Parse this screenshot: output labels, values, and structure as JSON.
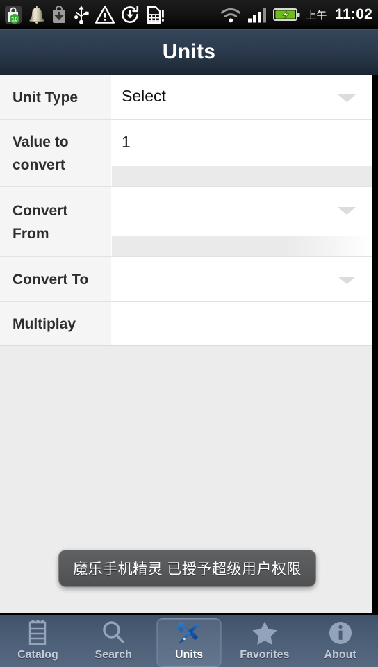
{
  "status_bar": {
    "left_icons": [
      {
        "name": "shop-bag-icon",
        "badge": "10"
      },
      {
        "name": "bell-icon",
        "badge": ""
      },
      {
        "name": "download-bag-icon",
        "badge": ""
      },
      {
        "name": "usb-icon",
        "badge": ""
      },
      {
        "name": "warning-triangle-icon",
        "badge": ""
      },
      {
        "name": "sync-download-icon",
        "badge": ""
      },
      {
        "name": "sim-card-alert-icon",
        "badge": ""
      }
    ],
    "wifi_icon": "wifi-icon",
    "signal_icon": "cellular-signal-icon",
    "battery_icon": "battery-charging-icon",
    "am_pm": "上午",
    "time": "11:02"
  },
  "header": {
    "title": "Units"
  },
  "form": {
    "rows": [
      {
        "key": "unit-type",
        "label": "Unit Type",
        "value": "Select",
        "has_caret": true,
        "has_strip": false
      },
      {
        "key": "value-to-convert",
        "label": "Value to convert",
        "value": "1",
        "has_caret": false,
        "has_strip": true
      },
      {
        "key": "convert-from",
        "label": "Convert From",
        "value": "",
        "has_caret": true,
        "has_strip": true
      },
      {
        "key": "convert-to",
        "label": "Convert To",
        "value": "",
        "has_caret": true,
        "has_strip": false
      },
      {
        "key": "multiplay",
        "label": "Multiplay",
        "value": "",
        "has_caret": false,
        "has_strip": false
      }
    ]
  },
  "toast": {
    "message": "魔乐手机精灵 已授予超级用户权限"
  },
  "tabbar": {
    "tabs": [
      {
        "label": "Catalog",
        "icon": "notepad-icon",
        "active": false
      },
      {
        "label": "Search",
        "icon": "search-icon",
        "active": false
      },
      {
        "label": "Units",
        "icon": "tools-icon",
        "active": true
      },
      {
        "label": "Favorites",
        "icon": "star-icon",
        "active": false
      },
      {
        "label": "About",
        "icon": "info-icon",
        "active": false
      }
    ]
  },
  "colors": {
    "titlebar_top": "#36475c",
    "titlebar_bottom": "#1b2532",
    "tabbar_top": "#3f5168",
    "tabbar_bottom": "#56697f",
    "active_tab_icon": "#1f5fb4",
    "badge_green": "#3aa537",
    "battery_green": "#6dbb1e"
  }
}
